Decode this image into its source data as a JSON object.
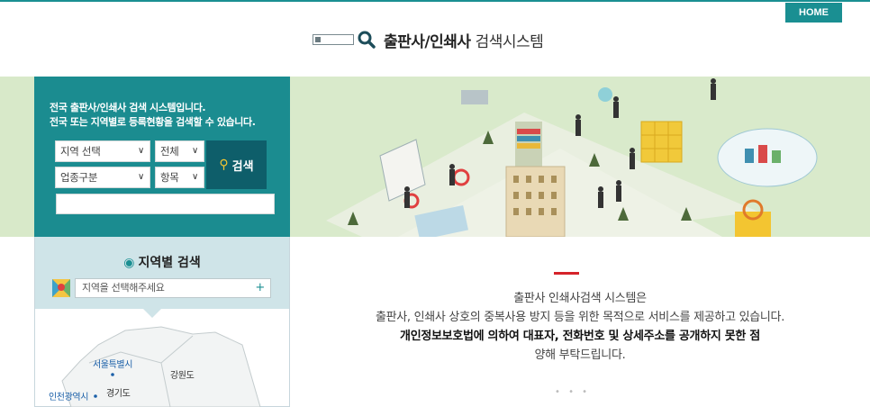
{
  "header": {
    "home_label": "HOME",
    "logo_title": "출판사/인쇄사",
    "logo_sub": "검색시스템"
  },
  "search_panel": {
    "intro_line1": "전국 출판사/인쇄사 검색 시스템입니다.",
    "intro_line2": "전국 또는 지역별로 등록현황을 검색할 수 있습니다.",
    "region_select": "지역 선택",
    "scope_select": "전체",
    "industry_select": "업종구분",
    "item_select": "항목",
    "search_label": "검색",
    "keyword_value": ""
  },
  "region_search": {
    "title": "지역별 검색",
    "placeholder": "지역을 선택해주세요",
    "map_labels": {
      "seoul": "서울특별시",
      "gangwon": "강원도",
      "gyeonggi": "경기도",
      "incheon": "인천광역시"
    }
  },
  "notice": {
    "line1": "출판사 인쇄사검색 시스템은",
    "line2": "출판사, 인쇄사 상호의 중복사용 방지 등을 위한 목적으로 서비스를 제공하고 있습니다.",
    "line3": "개인정보보호법에 의하여 대표자, 전화번호 및 상세주소를 공개하지 못한 점",
    "line4": "양해 부탁드립니다.",
    "pager_dots": "• • •"
  },
  "colors": {
    "accent": "#1a8f92",
    "panel": "#1b8c90",
    "button_dark": "#0e5e6a",
    "banner_bg": "#d8e9c9",
    "red": "#d5232a"
  }
}
